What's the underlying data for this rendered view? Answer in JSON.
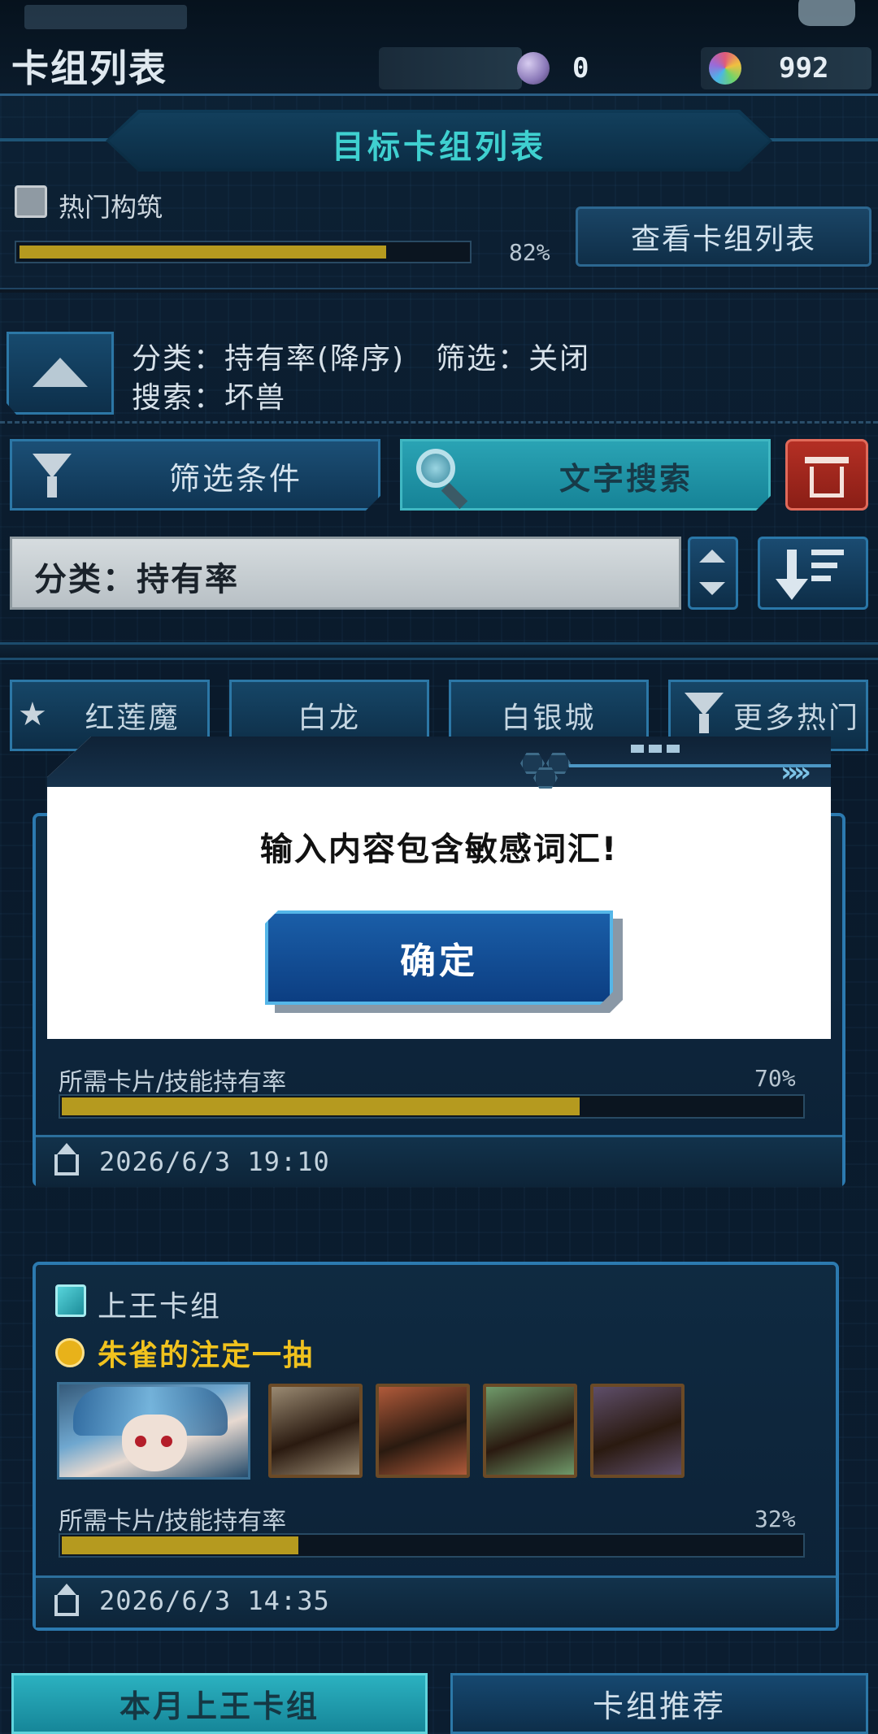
{
  "header": {
    "title": "卡组列表",
    "currency": [
      {
        "icon": "orb-icon",
        "value": "0",
        "color": "#9a86c8"
      },
      {
        "icon": "rainbow-gem-icon",
        "value": "992",
        "color": "#7fd46a"
      }
    ]
  },
  "banner": {
    "title": "目标卡组列表"
  },
  "popular": {
    "label": "热门构筑",
    "percent_text": "82%",
    "progress": 0.82,
    "view_button": "查看卡组列表"
  },
  "sort_info": {
    "line1": "分类：持有率(降序)　筛选：关闭",
    "line2": "搜索：坏兽"
  },
  "controls": {
    "filter_button": "筛选条件",
    "search_button": "文字搜索",
    "sort_select_value": "分类：持有率"
  },
  "tags": [
    {
      "label": "红莲魔"
    },
    {
      "label": "白龙"
    },
    {
      "label": "白银城"
    },
    {
      "label": "更多热门"
    }
  ],
  "decks": [
    {
      "req_label": "所需卡片/技能持有率",
      "percent_text": "70%",
      "progress": 0.7,
      "date": "2026/6/3 19:10"
    },
    {
      "title": "上王卡组",
      "skill": "朱雀的注定一抽",
      "req_label": "所需卡片/技能持有率",
      "percent_text": "32%",
      "progress": 0.32,
      "date": "2026/6/3 14:35",
      "cards": [
        {
          "color": "#9a8a72"
        },
        {
          "color": "#b05a3a"
        },
        {
          "color": "#6f9a6a"
        },
        {
          "color": "#5e4e6a"
        }
      ]
    }
  ],
  "dialog": {
    "message": "输入内容包含敏感词汇!",
    "ok_button": "确定"
  },
  "bottom_tabs": {
    "left": "本月上王卡组",
    "right": "卡组推荐"
  },
  "colors": {
    "accent_cyan": "#3fd0d0",
    "progress_gold": "#b59a1f",
    "skill_gold": "#f0c21e",
    "danger_red": "#b42f24"
  }
}
